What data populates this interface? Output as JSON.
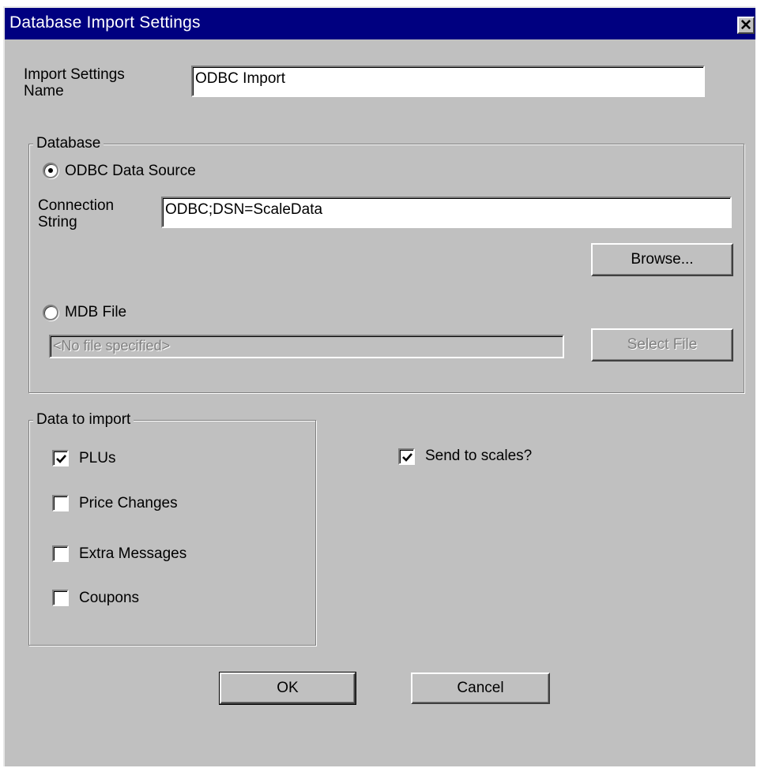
{
  "window": {
    "title": "Database Import Settings",
    "close_icon": "close-icon"
  },
  "settings_name": {
    "label": "Import Settings Name",
    "value": "ODBC Import"
  },
  "database": {
    "group_label": "Database",
    "odbc_radio_label": "ODBC Data Source",
    "odbc_selected": true,
    "connection_label": "Connection String",
    "connection_value": "ODBC;DSN=ScaleData",
    "browse_label": "Browse...",
    "mdb_radio_label": "MDB File",
    "mdb_selected": false,
    "mdb_file_value": "<No file specified>",
    "select_file_label": "Select File"
  },
  "data_to_import": {
    "group_label": "Data to import",
    "items": [
      {
        "label": "PLUs",
        "checked": true
      },
      {
        "label": "Price Changes",
        "checked": false
      },
      {
        "label": "Extra Messages",
        "checked": false
      },
      {
        "label": "Coupons",
        "checked": false
      }
    ]
  },
  "send_to_scales": {
    "label": "Send to scales?",
    "checked": true
  },
  "buttons": {
    "ok": "OK",
    "cancel": "Cancel"
  }
}
